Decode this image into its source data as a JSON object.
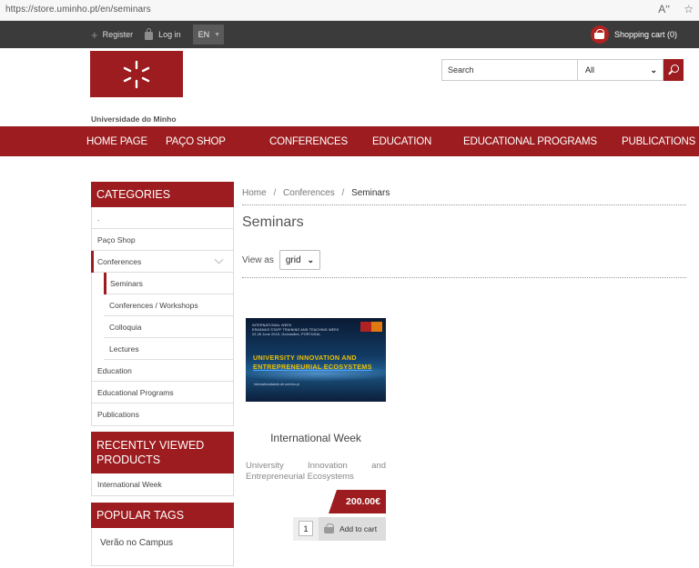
{
  "browser": {
    "url": "https://store.uminho.pt/en/seminars",
    "read_aloud_icon": "Aʹʹ",
    "favorite_icon": "☆"
  },
  "topbar": {
    "register": "Register",
    "login": "Log in",
    "language": "EN",
    "cart": "Shopping cart (0)",
    "icons": [
      "plus-icon",
      "lock-icon",
      "cart-icon"
    ]
  },
  "header": {
    "logo_name": "Universidade do Minho",
    "search_placeholder": "Search",
    "search_category": "All",
    "brand_color": "#9c1c1f"
  },
  "nav": {
    "items": [
      "HOME PAGE",
      "PAÇO SHOP",
      "CONFERENCES",
      "EDUCATION",
      "EDUCATIONAL PROGRAMS",
      "PUBLICATIONS"
    ]
  },
  "sidebar": {
    "categories_title": "CATEGORIES",
    "categories": [
      ".",
      "Paço Shop",
      "Conferences",
      "Education",
      "Educational Programs",
      "Publications"
    ],
    "conference_sub": [
      "Seminars",
      "Conferences / Workshops",
      "Colloquia",
      "Lectures"
    ],
    "recent_title": "RECENTLY VIEWED PRODUCTS",
    "recent_items": [
      "International Week"
    ],
    "tags_title": "POPULAR TAGS",
    "tags": [
      "Verão no Campus"
    ]
  },
  "main": {
    "breadcrumb": [
      "Home",
      "Conferences",
      "Seminars"
    ],
    "breadcrumb_sep": "/",
    "title": "Seminars",
    "view_as_label": "View as",
    "view_as_value": "grid"
  },
  "product": {
    "image": {
      "small_title": "INTERNATIONAL WEEK",
      "small_sub": "ERASMUS STAFF TRAINING AND TEACHING WEEK",
      "small_date": "22-26 June 2015, Guimarães, PORTUGAL",
      "big_line1": "UNIVERSITY INNOVATION AND",
      "big_line2": "ENTREPRENEURIAL ECOSYSTEMS",
      "footer": "internationalweek.dri.uminho.pt"
    },
    "title": "International Week",
    "description": "University Innovation and Entrepreneurial Ecosystems",
    "price": "200.00€",
    "quantity": "1",
    "add_to_cart": "Add to cart"
  }
}
